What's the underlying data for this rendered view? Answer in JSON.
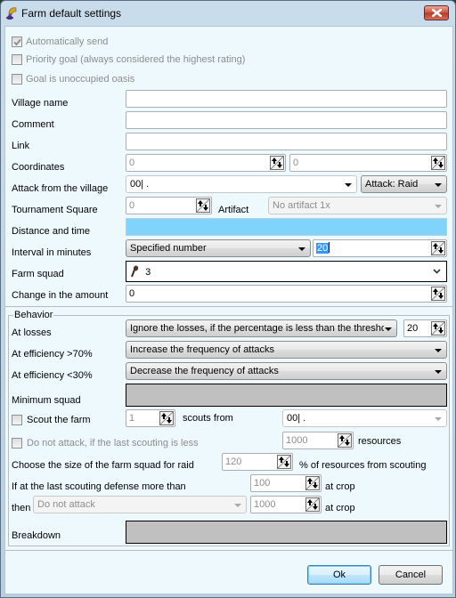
{
  "window": {
    "title": "Farm default settings",
    "icons": {
      "app": "farm-app-icon",
      "close": "close-icon"
    }
  },
  "options": {
    "auto_send": {
      "label": "Automatically send",
      "checked": true,
      "enabled": false
    },
    "priority_goal": {
      "label": "Priority goal (always considered the highest rating)",
      "checked": false,
      "enabled": false
    },
    "unoccupied_oasis": {
      "label": "Goal is unoccupied oasis",
      "checked": false,
      "enabled": false
    }
  },
  "fields": {
    "village_name": {
      "label": "Village name",
      "value": ""
    },
    "comment": {
      "label": "Comment",
      "value": ""
    },
    "link": {
      "label": "Link",
      "value": ""
    },
    "coordinates": {
      "label": "Coordinates",
      "x": "0",
      "y": "0"
    },
    "attack_from": {
      "label": "Attack from the village",
      "value": "00| .",
      "attack_type": "Attack: Raid"
    },
    "tournament_square": {
      "label": "Tournament Square",
      "value": "0"
    },
    "artifact": {
      "label": "Artifact",
      "value": "No artifact 1x"
    },
    "distance_time": {
      "label": "Distance and time",
      "value": ""
    },
    "interval": {
      "label": "Interval in minutes",
      "mode": "Specified number",
      "value": "20"
    },
    "farm_squad": {
      "label": "Farm squad",
      "value": "3",
      "unit_icon": "club-icon"
    },
    "change_amount": {
      "label": "Change in the amount",
      "value": "0"
    }
  },
  "behavior": {
    "legend": "Behavior",
    "at_losses": {
      "label": "At losses",
      "value": "Ignore the losses, if the percentage is less than the threshold",
      "threshold": "20"
    },
    "eff_high": {
      "label": "At efficiency >70%",
      "value": "Increase the frequency of attacks"
    },
    "eff_low": {
      "label": "At efficiency <30%",
      "value": "Decrease the frequency of attacks"
    },
    "min_squad": {
      "label": "Minimum squad",
      "value": ""
    },
    "scout": {
      "label": "Scout the farm",
      "checked": false,
      "count": "1",
      "from_label": "scouts from",
      "from_value": "00| ."
    },
    "no_attack_scout": {
      "label": "Do not attack, if the last scouting is less",
      "checked": false,
      "enabled": false,
      "value": "1000",
      "unit": "resources"
    },
    "squad_size": {
      "label": "Choose the size of the farm squad for raid",
      "value": "120",
      "unit": "% of resources from scouting"
    },
    "defense": {
      "label": "If at the last scouting defense more than",
      "value": "100",
      "unit": "at crop"
    },
    "then": {
      "label": "then",
      "action": "Do not attack",
      "value": "1000",
      "unit": "at crop"
    },
    "breakdown": {
      "label": "Breakdown",
      "value": ""
    }
  },
  "buttons": {
    "ok": "Ok",
    "cancel": "Cancel"
  }
}
